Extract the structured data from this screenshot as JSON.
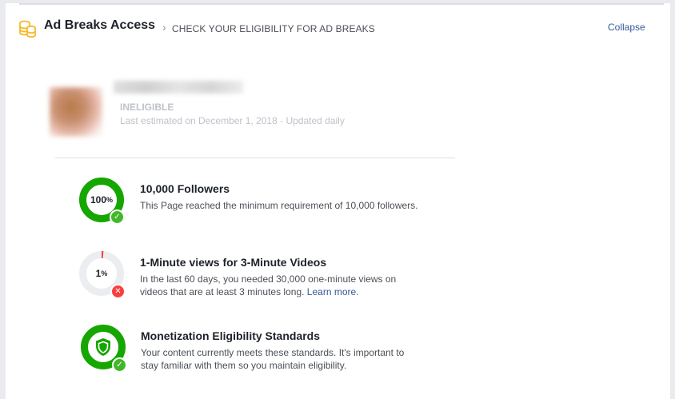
{
  "header": {
    "title": "Ad Breaks Access",
    "subtitle": "CHECK YOUR ELIGIBILITY FOR AD BREAKS",
    "collapse_label": "Collapse"
  },
  "profile": {
    "status": "INELIGIBLE",
    "estimated": "Last estimated on December 1, 2018 - Updated daily"
  },
  "requirements": [
    {
      "percent": "100",
      "percent_sign": "%",
      "progress": 1.0,
      "met": true,
      "title": "10,000 Followers",
      "description": "This Page reached the minimum requirement of 10,000 followers."
    },
    {
      "percent": "1",
      "percent_sign": "%",
      "progress": 0.01,
      "met": false,
      "title": "1-Minute views for 3-Minute Videos",
      "description": "In the last 60 days, you needed 30,000 one-minute views on videos that are at least 3 minutes long.",
      "link": "Learn more."
    },
    {
      "met": true,
      "title": "Monetization Eligibility Standards",
      "description": "Your content currently meets these standards. It's important to stay familiar with them so you maintain eligibility."
    }
  ],
  "icons": {
    "header": "coins-icon",
    "chevron": "chevron-right-icon",
    "check": "check-icon",
    "cross": "cross-icon",
    "shield": "shield-icon"
  },
  "colors": {
    "green": "#42b72a",
    "ring_green": "#16a600",
    "red": "#fa3e3e",
    "link": "#365899",
    "ring_track": "#ebedf0",
    "coin": "#f7b928"
  }
}
